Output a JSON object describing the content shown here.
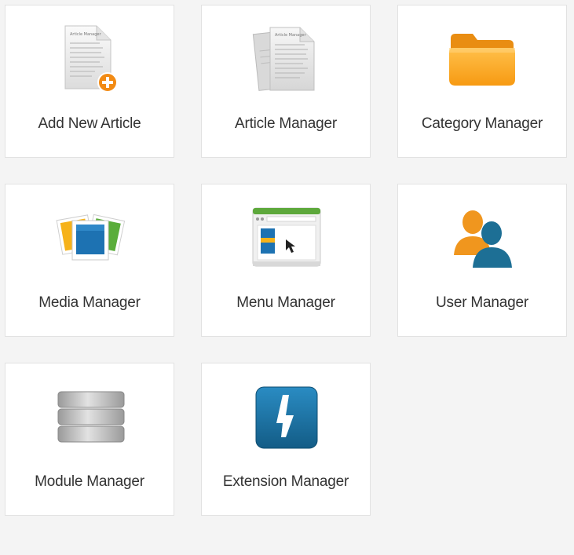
{
  "tiles": [
    {
      "label": "Add New Article",
      "icon": "add-article-icon"
    },
    {
      "label": "Article Manager",
      "icon": "articles-icon"
    },
    {
      "label": "Category Manager",
      "icon": "folder-icon"
    },
    {
      "label": "Media Manager",
      "icon": "media-icon"
    },
    {
      "label": "Menu Manager",
      "icon": "menu-window-icon"
    },
    {
      "label": "User Manager",
      "icon": "users-icon"
    },
    {
      "label": "Module Manager",
      "icon": "database-icon"
    },
    {
      "label": "Extension Manager",
      "icon": "lightning-icon"
    }
  ],
  "icon_snippet_text": "Article Manager",
  "colors": {
    "page_bg": "#f4f4f4",
    "tile_bg": "#ffffff",
    "tile_border": "#e2e2e2",
    "label": "#333333",
    "folder": "#fba31f",
    "plus_badge": "#f28b15",
    "user_orange": "#f0961e",
    "user_blue": "#1d6f95",
    "extension_blue": "#1c76a8",
    "menu_green": "#5da83b"
  }
}
